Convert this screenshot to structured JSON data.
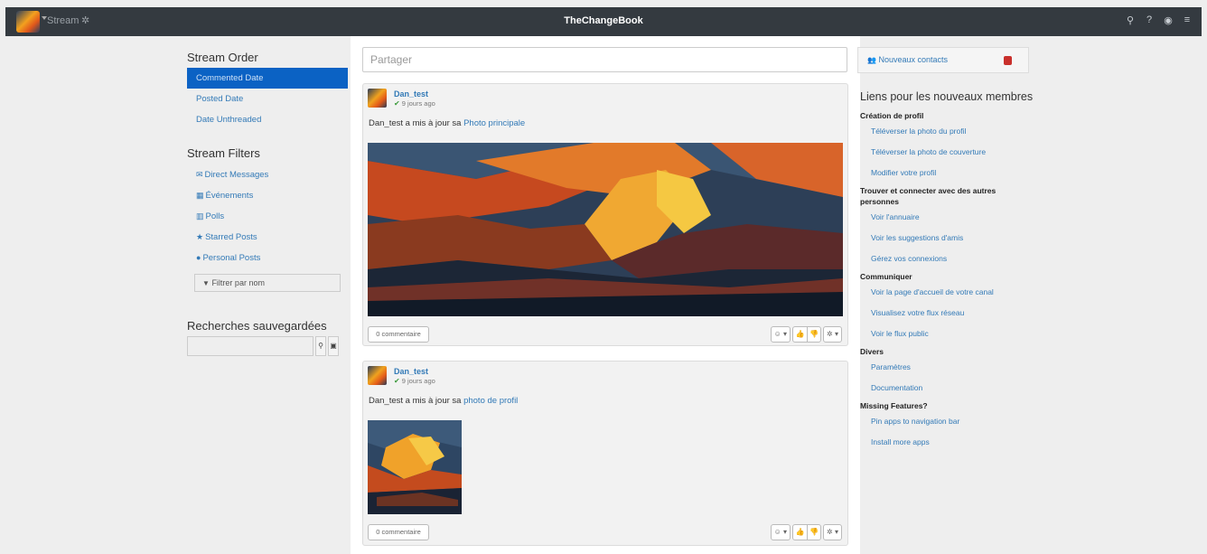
{
  "topbar": {
    "section": "Stream",
    "brand": "TheChangeBook",
    "icons": [
      "search-icon",
      "question-icon",
      "user-circle-icon",
      "menu-icon"
    ]
  },
  "left": {
    "stream_order": {
      "title": "Stream Order",
      "items": [
        "Commented Date",
        "Posted Date",
        "Date Unthreaded"
      ],
      "active": "Commented Date"
    },
    "stream_filters": {
      "title": "Stream Filters",
      "items": [
        {
          "label": "Direct Messages",
          "icon": "envelope-icon"
        },
        {
          "label": "Événements",
          "icon": "calendar-icon"
        },
        {
          "label": "Polls",
          "icon": "bar-chart-icon"
        },
        {
          "label": "Starred Posts",
          "icon": "star-icon"
        },
        {
          "label": "Personal Posts",
          "icon": "user-circle-icon"
        }
      ],
      "filter_placeholder": "Filtrer par nom"
    },
    "saved_searches": {
      "title": "Recherches sauvegardées",
      "search_value": ""
    }
  },
  "center": {
    "share_placeholder": "Partager",
    "posts": [
      {
        "author": "Dan_test",
        "ago": "9 jours ago",
        "text": "Dan_test a mis à jour sa ",
        "link": "Photo principale",
        "comments": "0 commentaire"
      },
      {
        "author": "Dan_test",
        "ago": "9 jours ago",
        "text": "Dan_test a mis à jour sa ",
        "link": "photo de profil",
        "comments": "0 commentaire"
      }
    ]
  },
  "right": {
    "new_contacts": "Nouveaux contacts",
    "new_contacts_count": "",
    "links_title": "Liens pour les nouveaux membres",
    "sections": [
      {
        "title": "Création de profil",
        "links": [
          "Téléverser la photo du profil",
          "Téléverser la photo de couverture",
          "Modifier votre profil"
        ]
      },
      {
        "title": "Trouver et connecter avec des autres personnes",
        "links": [
          "Voir l'annuaire",
          "Voir les suggestions d'amis",
          "Gérez vos connexions"
        ]
      },
      {
        "title": "Communiquer",
        "links": [
          "Voir la page d'accueil de votre canal",
          "Visualisez votre flux réseau",
          "Voir le flux public"
        ]
      },
      {
        "title": "Divers",
        "links": [
          "Paramètres",
          "Documentation"
        ]
      },
      {
        "title": "Missing Features?",
        "links": [
          "Pin apps to navigation bar",
          "Install more apps"
        ]
      }
    ]
  },
  "colors": {
    "topbar": "#343a40",
    "accent": "#0b62c4",
    "link": "#337ab7"
  }
}
